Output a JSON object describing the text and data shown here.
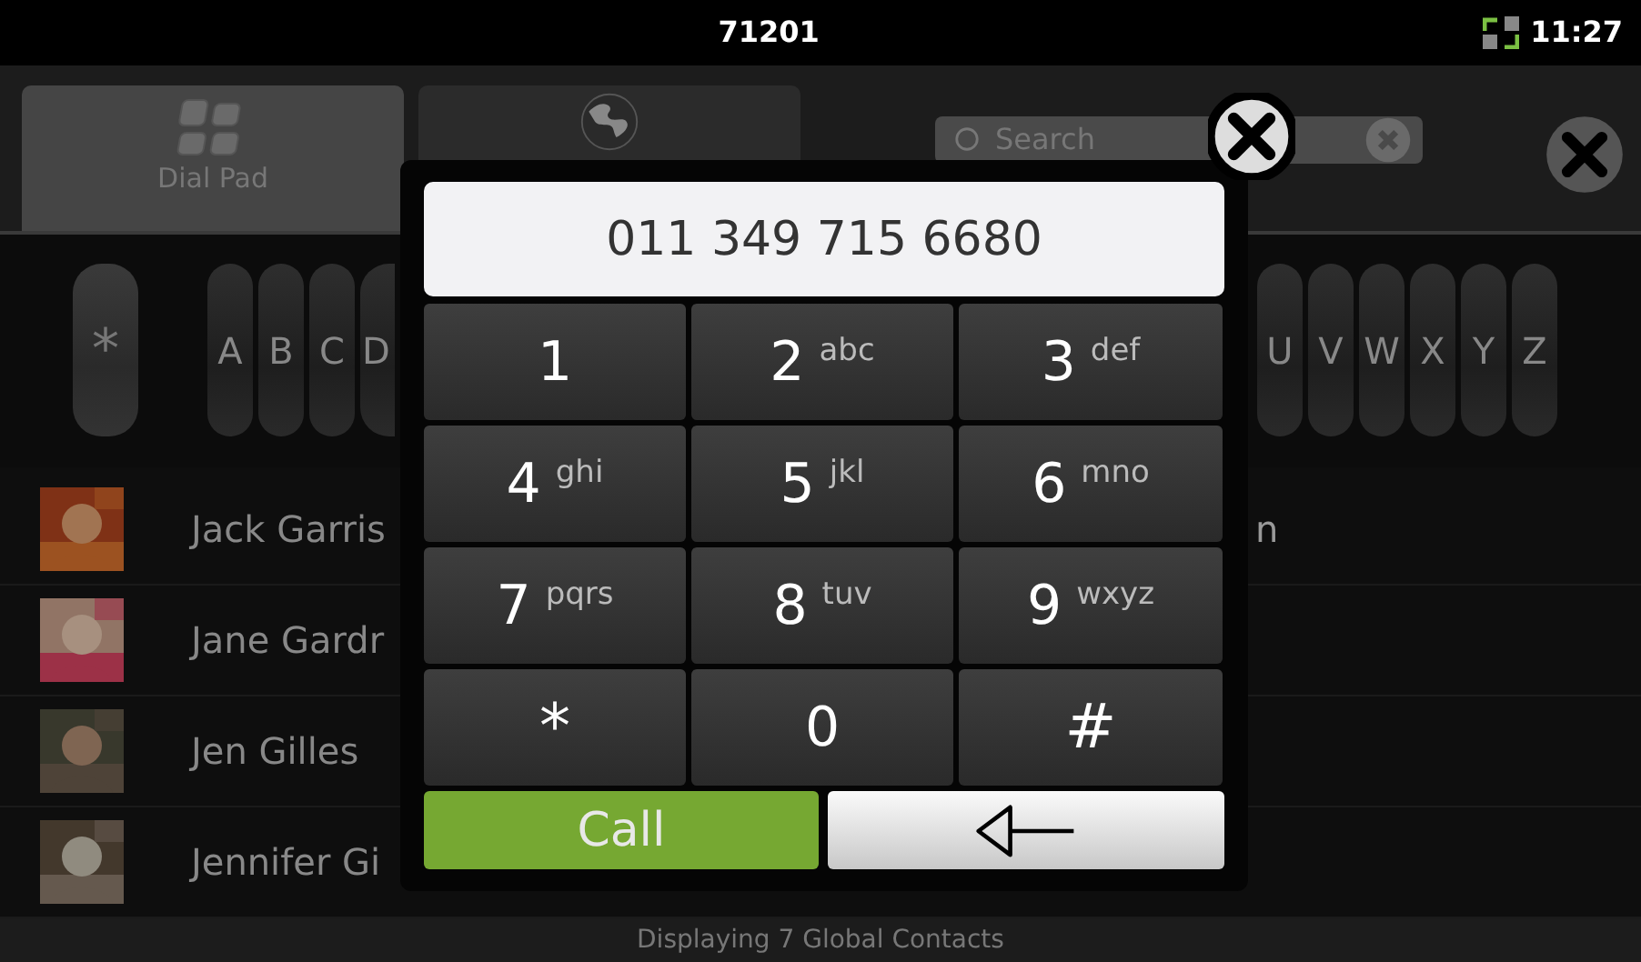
{
  "status_bar": {
    "title": "71201",
    "time": "11:27"
  },
  "tabs": [
    {
      "kind": "dialpad",
      "label": "Dial Pad",
      "selected": true
    },
    {
      "kind": "globe",
      "selected": false
    }
  ],
  "search": {
    "placeholder": "Search"
  },
  "index_bar": {
    "symbol": "*",
    "letters_left": [
      "A",
      "B",
      "C",
      "D"
    ],
    "letters_right": [
      "U",
      "V",
      "W",
      "X",
      "Y",
      "Z"
    ]
  },
  "contacts": [
    {
      "name": "Jack Garris",
      "name_tail": "n"
    },
    {
      "name": "Jane Gardr"
    },
    {
      "name": "Jen Gilles"
    },
    {
      "name": "Jennifer Gi"
    }
  ],
  "status_text": "Displaying 7 Global Contacts",
  "dialog": {
    "number": "011 349 715 6680",
    "keys": [
      {
        "digit": "1"
      },
      {
        "digit": "2",
        "letters": "abc"
      },
      {
        "digit": "3",
        "letters": "def"
      },
      {
        "digit": "4",
        "letters": "ghi"
      },
      {
        "digit": "5",
        "letters": "jkl"
      },
      {
        "digit": "6",
        "letters": "mno"
      },
      {
        "digit": "7",
        "letters": "pqrs"
      },
      {
        "digit": "8",
        "letters": "tuv"
      },
      {
        "digit": "9",
        "letters": "wxyz"
      },
      {
        "digit": "*"
      },
      {
        "digit": "0"
      },
      {
        "digit": "#"
      }
    ],
    "call_label": "Call"
  }
}
